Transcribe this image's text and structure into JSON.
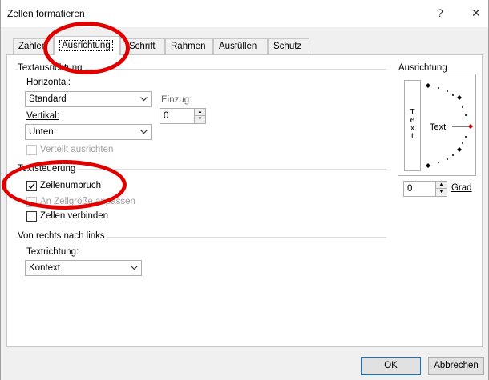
{
  "window": {
    "title": "Zellen formatieren",
    "help_label": "?",
    "close_label": "✕"
  },
  "tabs": [
    {
      "label": "Zahlen"
    },
    {
      "label": "Ausrichtung"
    },
    {
      "label": "Schrift"
    },
    {
      "label": "Rahmen"
    },
    {
      "label": "Ausfüllen"
    },
    {
      "label": "Schutz"
    }
  ],
  "text_alignment": {
    "group_label": "Textausrichtung",
    "horizontal_label": "Horizontal:",
    "horizontal_value": "Standard",
    "vertical_label": "Vertikal:",
    "vertical_value": "Unten",
    "indent_label": "Einzug:",
    "indent_value": "0",
    "justify_distributed_label": "Verteilt ausrichten"
  },
  "text_control": {
    "group_label": "Textsteuerung",
    "wrap_text_label": "Zeilenumbruch",
    "wrap_text_checked": true,
    "shrink_to_fit_label": "An Zellgröße anpassen",
    "merge_cells_label": "Zellen verbinden"
  },
  "rtl": {
    "group_label": "Von rechts nach links",
    "direction_label": "Textrichtung:",
    "direction_value": "Kontext"
  },
  "orientation": {
    "group_label": "Ausrichtung",
    "vertical_text_letters": [
      "T",
      "e",
      "x",
      "t"
    ],
    "dial_text": "Text",
    "degrees_value": "0",
    "degrees_label": "Grad"
  },
  "buttons": {
    "ok_label": "OK",
    "cancel_label": "Abbrechen"
  },
  "colors": {
    "highlight_ellipse": "#e00000",
    "indicator": "#c00000"
  }
}
